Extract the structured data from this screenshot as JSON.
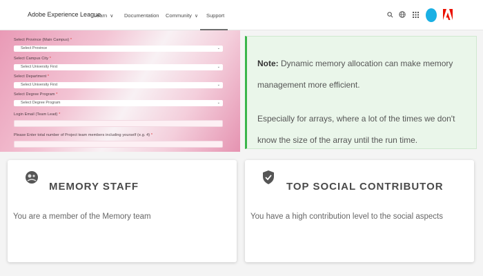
{
  "nav": {
    "brand": "Adobe Experience League",
    "items": [
      {
        "label": "Learn",
        "caret": "∨"
      },
      {
        "label": "Documentation",
        "caret": ""
      },
      {
        "label": "Community",
        "caret": "∨"
      },
      {
        "label": "Support",
        "caret": ""
      }
    ],
    "active": "Support",
    "icons": [
      "search-icon",
      "globe-icon",
      "apps-grid-icon",
      "user-avatar",
      "adobe-logo"
    ]
  },
  "form": {
    "fields": [
      {
        "label": "Select Province (Main Campus)",
        "required": "*",
        "value": "Select Province"
      },
      {
        "label": "Select Campus City",
        "required": "*",
        "value": "Select University First"
      },
      {
        "label": "Select Department",
        "required": "*",
        "value": "Select University First"
      },
      {
        "label": "Select Degree Program",
        "required": "*",
        "value": "Select Degree Program"
      }
    ],
    "inputs": [
      {
        "label": "Login Email (Team Lead)",
        "required": "*",
        "value": ""
      },
      {
        "label": "Please Enter total number of Project team members including yourself (e.g. 4)",
        "required": "*",
        "value": ""
      }
    ]
  },
  "note": {
    "prefix": "Note:",
    "line1": "Dynamic memory allocation can make memory management more efficient.",
    "line2": "Especially for arrays, where a lot of the times we don't know the size of the array until the run time."
  },
  "badges": [
    {
      "title": "MEMORY STAFF",
      "description": "You are a member of the Memory team",
      "icon": "memory-badge-icon"
    },
    {
      "title": "TOP SOCIAL CONTRIBUTOR",
      "description": "You have a high contribution level to the social aspects",
      "icon": "shield-check-icon"
    }
  ],
  "colors": {
    "note_accent": "#39b54a",
    "avatar": "#1ab0e4",
    "adobe_red": "#eb1000"
  }
}
